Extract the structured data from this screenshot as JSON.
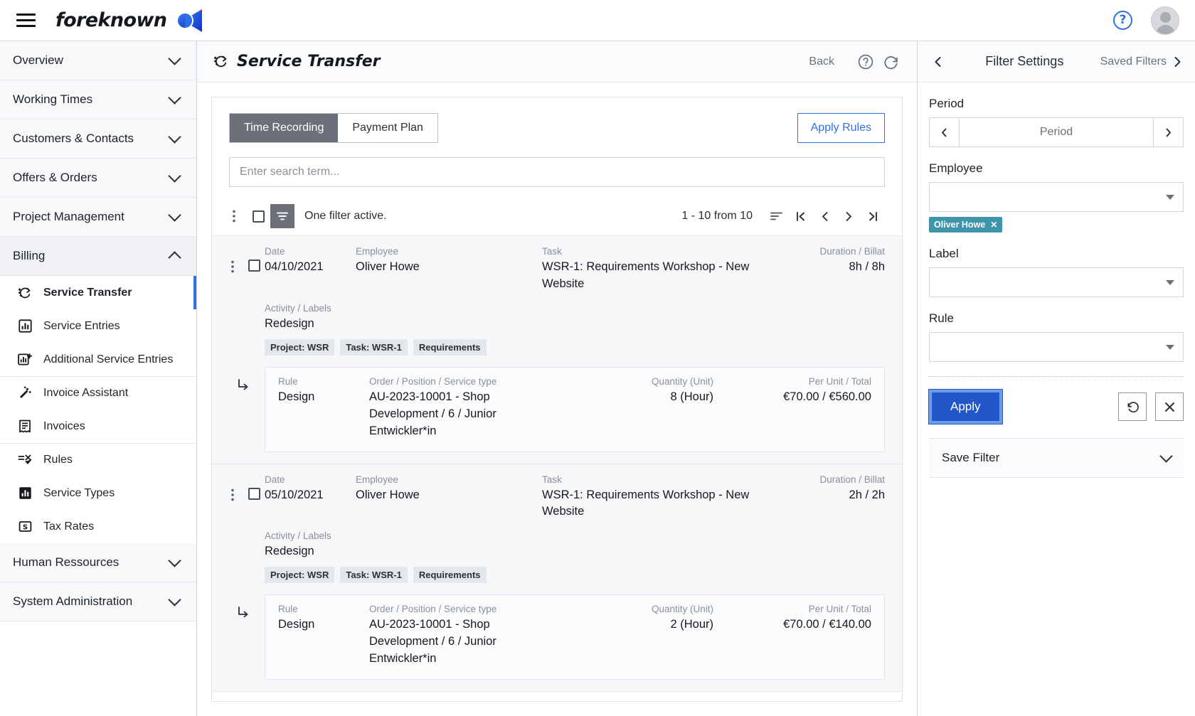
{
  "topbar": {
    "menu_icon": "hamburger-icon",
    "brand": "foreknown",
    "help_glyph": "?",
    "avatar_label": "user-avatar"
  },
  "sidebar": {
    "groups": [
      {
        "label": "Overview",
        "state": "collapsed"
      },
      {
        "label": "Working Times",
        "state": "collapsed"
      },
      {
        "label": "Customers & Contacts",
        "state": "collapsed"
      },
      {
        "label": "Offers & Orders",
        "state": "collapsed"
      },
      {
        "label": "Project Management",
        "state": "collapsed"
      },
      {
        "label": "Billing",
        "state": "expanded"
      }
    ],
    "billing_items": [
      {
        "label": "Service Transfer",
        "icon": "service-transfer-icon",
        "active": true
      },
      {
        "label": "Service Entries",
        "icon": "chart-box-icon",
        "active": false
      },
      {
        "label": "Additional Service Entries",
        "icon": "chart-box-plus-icon",
        "active": false
      },
      {
        "label": "Invoice Assistant",
        "icon": "magic-wand-icon",
        "active": false
      },
      {
        "label": "Invoices",
        "icon": "receipt-icon",
        "active": false
      },
      {
        "label": "Rules",
        "icon": "rules-icon",
        "active": false
      },
      {
        "label": "Service Types",
        "icon": "bar-chart-icon",
        "active": false
      },
      {
        "label": "Tax Rates",
        "icon": "tax-icon",
        "active": false
      }
    ],
    "groups_after": [
      {
        "label": "Human Ressources",
        "state": "collapsed"
      },
      {
        "label": "System Administration",
        "state": "collapsed"
      }
    ]
  },
  "page": {
    "title": "Service Transfer",
    "title_icon": "service-transfer-icon",
    "back_label": "Back",
    "help_icon": "help-circle-icon",
    "refresh_icon": "refresh-icon"
  },
  "tabs": [
    {
      "label": "Time Recording",
      "selected": true
    },
    {
      "label": "Payment Plan",
      "selected": false
    }
  ],
  "apply_rules_button": "Apply Rules",
  "search": {
    "placeholder": "Enter search term...",
    "value": ""
  },
  "toolbar": {
    "more_icon": "kebab-menu-icon",
    "select_all_icon": "checkbox-icon",
    "filter_icon": "filter-icon",
    "filter_status": "One filter active.",
    "count": "1 - 10 from 10",
    "sort_icon": "sort-icon",
    "first_icon": "first-page-icon",
    "prev_icon": "prev-page-icon",
    "next_icon": "next-page-icon",
    "last_icon": "last-page-icon"
  },
  "columns": {
    "date": "Date",
    "employee": "Employee",
    "task": "Task",
    "duration": "Duration / Billat",
    "activity": "Activity / Labels",
    "rule": "Rule",
    "order": "Order / Position / Service type",
    "quantity": "Quantity (Unit)",
    "per_unit": "Per Unit / Total"
  },
  "records": [
    {
      "date": "04/10/2021",
      "employee": "Oliver Howe",
      "task": "WSR-1: Requirements Workshop - New Website",
      "duration": "8h / 8h",
      "activity": "Redesign",
      "chips": [
        "Project: WSR",
        "Task: WSR-1",
        "Requirements"
      ],
      "sub": {
        "rule": "Design",
        "order": "AU-2023-10001 - Shop Development / 6 / Junior Entwickler*in",
        "quantity": "8 (Hour)",
        "per_unit": "€70.00 / €560.00"
      }
    },
    {
      "date": "05/10/2021",
      "employee": "Oliver Howe",
      "task": "WSR-1: Requirements Workshop - New Website",
      "duration": "2h / 2h",
      "activity": "Redesign",
      "chips": [
        "Project: WSR",
        "Task: WSR-1",
        "Requirements"
      ],
      "sub": {
        "rule": "Design",
        "order": "AU-2023-10001 - Shop Development / 6 / Junior Entwickler*in",
        "quantity": "2 (Hour)",
        "per_unit": "€70.00 / €140.00"
      }
    }
  ],
  "filters": {
    "back_icon": "chevron-left-icon",
    "title": "Filter Settings",
    "saved_filters": "Saved Filters",
    "forward_icon": "chevron-right-icon",
    "period_label": "Period",
    "period_value": "Period",
    "period_prev_icon": "chevron-left-icon",
    "period_next_icon": "chevron-right-icon",
    "employee_label": "Employee",
    "employee_value": "",
    "employee_tag": "Oliver Howe",
    "employee_tag_remove": "✕",
    "label_label": "Label",
    "label_value": "",
    "rule_label": "Rule",
    "rule_value": "",
    "apply_label": "Apply",
    "reset_icon": "reset-icon",
    "clear_icon": "close-icon",
    "save_filter_label": "Save Filter",
    "save_filter_chevron": "chevron-down-icon",
    "accent_color": "#2257c9",
    "tag_color": "#3f96ab"
  }
}
